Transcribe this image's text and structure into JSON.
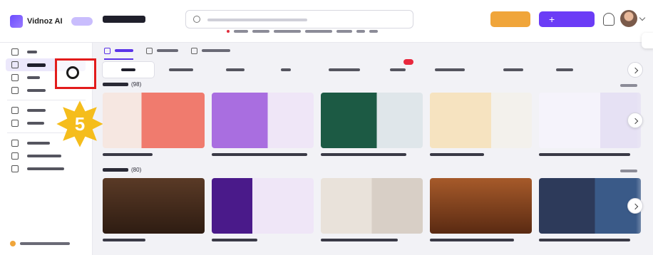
{
  "app": {
    "logo_text": "Vidnoz AI"
  },
  "header": {
    "create_label": "+"
  },
  "highlight": {
    "step": "5"
  },
  "sections": [
    {
      "count": "(98)"
    },
    {
      "count": "(80)"
    }
  ],
  "colors": {
    "accent": "#6b3cf6",
    "upgrade": "#f0a53a",
    "highlight": "#e21c1c",
    "step_badge": "#f5bd1c"
  }
}
